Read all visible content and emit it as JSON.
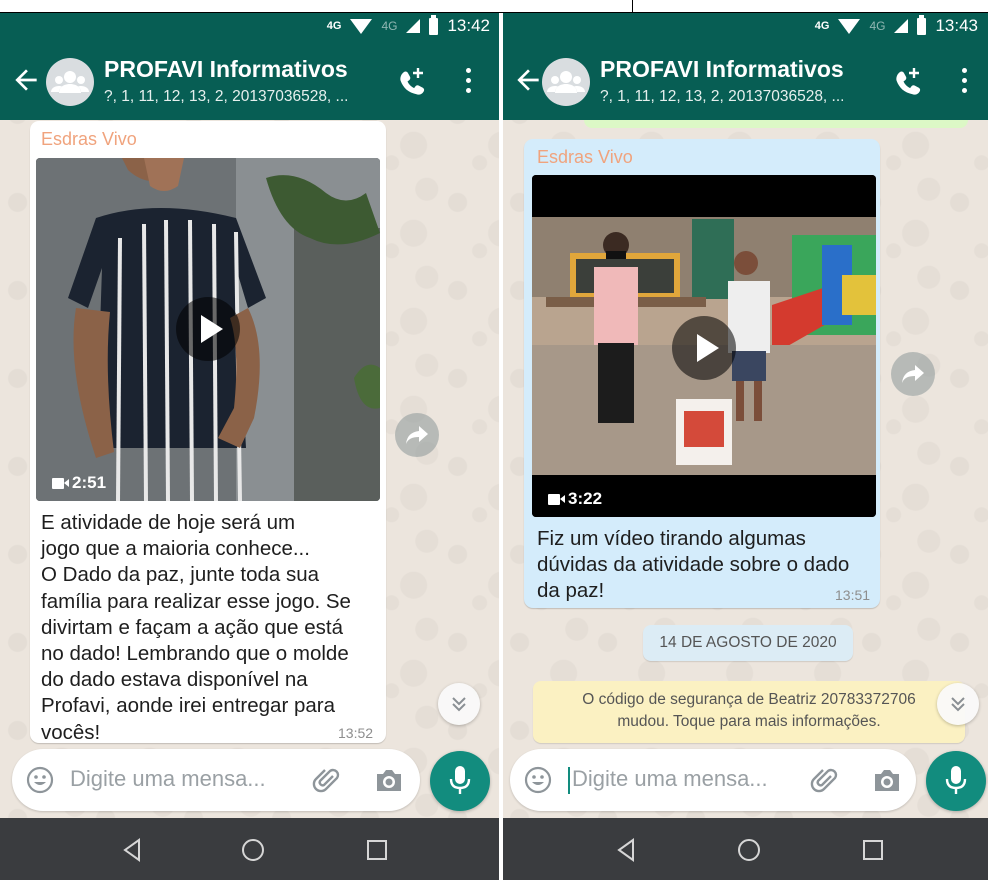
{
  "left": {
    "status": {
      "network": "4G",
      "lte": "4G",
      "time": "13:42"
    },
    "header": {
      "title": "PROFAVI Informativos",
      "subtitle": "?, 1, 11, 12, 13, 2, 20137036528, ..."
    },
    "message": {
      "sender": "Esdras Vivo",
      "video_duration": "2:51",
      "text_lines": [
        "E atividade de hoje será um",
        "jogo que a maioria conhece...",
        "O Dado da paz, junte toda sua",
        "família para realizar esse jogo. Se",
        "divirtam e façam a ação que está",
        "no dado! Lembrando que o molde",
        "do dado estava disponível na",
        "Profavi, aonde irei entregar para",
        "vocês!"
      ],
      "time": "13:52"
    },
    "input": {
      "placeholder": "Digite uma mensa..."
    }
  },
  "right": {
    "status": {
      "network": "4G",
      "lte": "4G",
      "time": "13:43"
    },
    "header": {
      "title": "PROFAVI Informativos",
      "subtitle": "?, 1, 11, 12, 13, 2, 20137036528, ..."
    },
    "message": {
      "sender": "Esdras Vivo",
      "video_duration": "3:22",
      "text_lines": [
        "Fiz um vídeo tirando algumas",
        "dúvidas da atividade sobre o dado",
        "da paz!"
      ],
      "time": "13:51"
    },
    "date_chip": "14 DE AGOSTO DE 2020",
    "system_note": {
      "line1": "O código de segurança de Beatriz 20783372706",
      "line2": "mudou. Toque para mais informações."
    },
    "input": {
      "placeholder": "Digite uma mensa..."
    }
  },
  "colors": {
    "header": "#075e54",
    "accent": "#128c7e",
    "sender_name": "#f0a37d",
    "outgoing_bubble": "#d4ecfb",
    "system_note_bg": "#fbf1c2",
    "navbar": "#3a3c3f"
  },
  "icons": [
    "back-arrow-icon",
    "group-avatar-icon",
    "call-add-icon",
    "menu-icon",
    "play-icon",
    "video-camera-icon",
    "forward-icon",
    "scroll-down-icon",
    "emoji-icon",
    "attach-icon",
    "camera-icon",
    "mic-icon",
    "nav-back-icon",
    "nav-home-icon",
    "nav-recents-icon"
  ]
}
